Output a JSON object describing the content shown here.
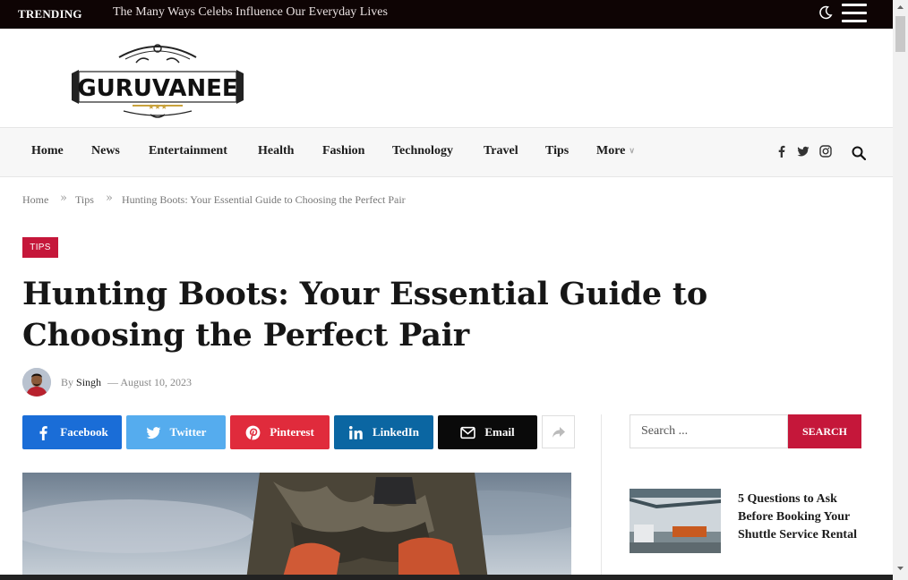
{
  "topbar": {
    "trending_label": "TRENDING",
    "trending_text": "The Many Ways Celebs Influence Our Everyday Lives"
  },
  "logo": {
    "text": "GURUVANEE"
  },
  "nav": {
    "items": [
      "Home",
      "News",
      "Entertainment",
      "Health",
      "Fashion",
      "Technology",
      "Travel",
      "Tips",
      "More"
    ]
  },
  "breadcrumb": {
    "items": [
      "Home",
      "Tips",
      "Hunting Boots: Your Essential Guide to Choosing the Perfect Pair"
    ],
    "separator": "»"
  },
  "article": {
    "category": "TIPS",
    "title": "Hunting Boots: Your Essential Guide to Choosing the Perfect Pair",
    "by_label": "By",
    "author": "Singh",
    "date_sep": "—",
    "date": "August 10, 2023"
  },
  "share": {
    "buttons": [
      {
        "label": "Facebook",
        "color": "#1a6dd7",
        "icon": "facebook-icon"
      },
      {
        "label": "Twitter",
        "color": "#55acee",
        "icon": "twitter-icon"
      },
      {
        "label": "Pinterest",
        "color": "#e02b3c",
        "icon": "pinterest-icon"
      },
      {
        "label": "LinkedIn",
        "color": "#0b66a2",
        "icon": "linkedin-icon"
      },
      {
        "label": "Email",
        "color": "#0a0a0a",
        "icon": "email-icon"
      }
    ]
  },
  "sidebar": {
    "search_placeholder": "Search ...",
    "search_button": "SEARCH",
    "posts": [
      {
        "title": "5 Questions to Ask Before Booking Your Shuttle Service Rental"
      }
    ]
  },
  "colors": {
    "accent": "#c5173a",
    "topbar": "#0e0404"
  }
}
